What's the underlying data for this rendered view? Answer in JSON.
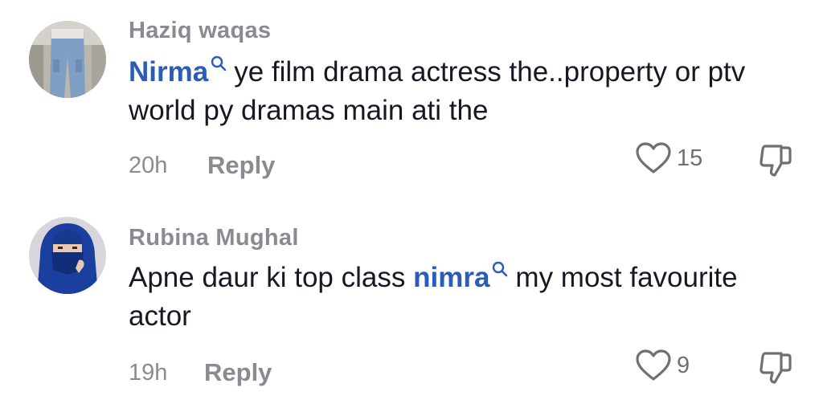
{
  "comments": [
    {
      "username": "Haziq waqas",
      "mention": "Nirma",
      "text_before": "",
      "text_after": "ye film drama actress the..property or ptv world py dramas main ati the",
      "time": "20h",
      "reply_label": "Reply",
      "like_count": "15",
      "avatar_icon": "user-avatar-jeans",
      "like_icon": "heart-outline-icon",
      "dislike_icon": "thumbs-down-outline-icon"
    },
    {
      "username": "Rubina Mughal",
      "mention": "nimra",
      "text_before": "Apne daur ki top class",
      "text_after": "my most favourite actor",
      "time": "19h",
      "reply_label": "Reply",
      "like_count": "9",
      "avatar_icon": "user-avatar-hijab",
      "like_icon": "heart-outline-icon",
      "dislike_icon": "thumbs-down-outline-icon"
    }
  ],
  "colors": {
    "mention": "#2b5db8",
    "muted": "#8a8b91",
    "text": "#161823",
    "icon": "#6f7077"
  }
}
